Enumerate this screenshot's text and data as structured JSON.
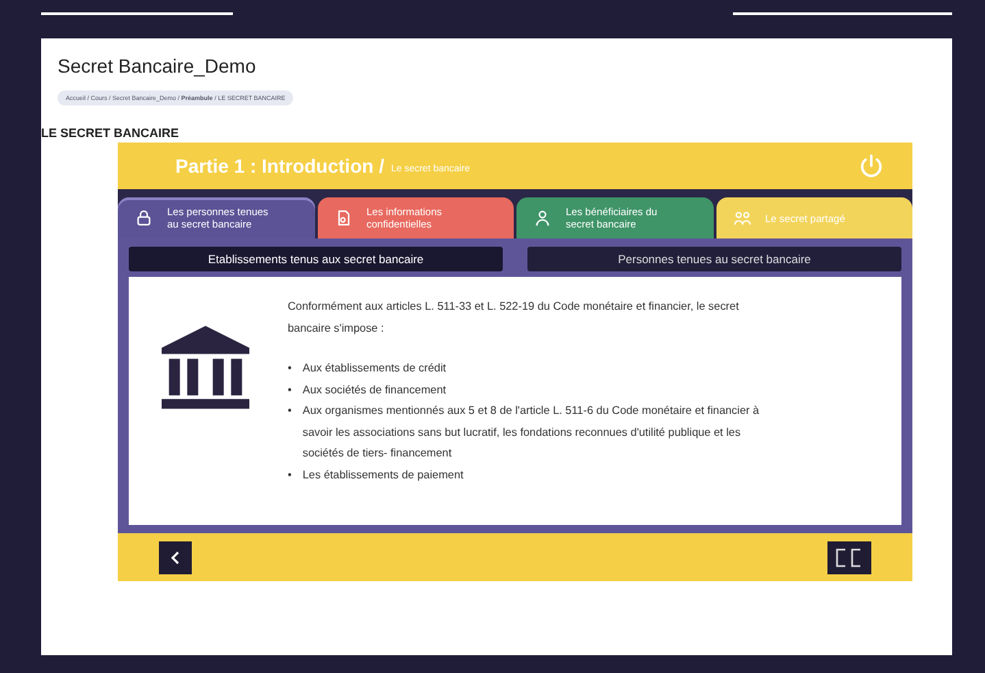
{
  "page": {
    "title": "Secret Bancaire_Demo",
    "breadcrumb": "Accueil / Cours / Secret Bancaire_Demo / **Préambule** / LE SECRET BANCAIRE",
    "heading": "LE SECRET BANCAIRE"
  },
  "module": {
    "title": "Partie 1 : Introduction /",
    "subtitle": "Le secret bancaire",
    "tabs": [
      {
        "label": "Les personnes tenues au secret bancaire",
        "color": "#5b5396",
        "selected": true
      },
      {
        "label": "Les informations confidentielles",
        "color": "#e8695f",
        "selected": false
      },
      {
        "label": "Les bénéficiaires du secret bancaire",
        "color": "#3f9468",
        "selected": false
      },
      {
        "label": "Le secret partagé",
        "color": "#f2d45a",
        "selected": false
      }
    ],
    "subtabs": [
      {
        "label": "Etablissements tenus aux secret bancaire",
        "selected": true
      },
      {
        "label": "Personnes tenues au secret bancaire",
        "selected": false
      }
    ],
    "intro": "Conformément aux articles L. 511-33 et L. 522-19 du Code monétaire et financier, le secret bancaire s'impose :",
    "items": [
      {
        "bullet": "•",
        "text": "Aux établissements de crédit"
      },
      {
        "bullet": "•",
        "text": "Aux sociétés de financement"
      },
      {
        "bullet": "•",
        "text": "Aux organismes mentionnés aux 5 et 8 de l'article L. 511-6 du Code monétaire et financier à savoir les associations sans but lucratif, les fondations reconnues d'utilité publique et les sociétés de tiers- financement"
      },
      {
        "bullet": "•",
        "text": "Les établissements de paiement"
      }
    ]
  }
}
